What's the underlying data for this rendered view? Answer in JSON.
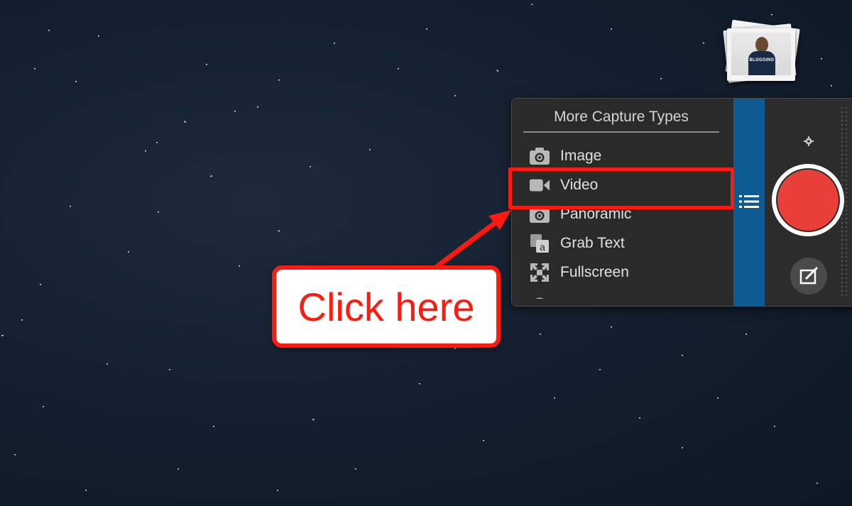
{
  "capture_menu": {
    "title": "More Capture Types",
    "items": [
      {
        "label": "Image",
        "icon": "camera-icon"
      },
      {
        "label": "Video",
        "icon": "video-camera-icon"
      },
      {
        "label": "Panoramic",
        "icon": "panoramic-camera-icon"
      },
      {
        "label": "Grab Text",
        "icon": "grab-text-icon"
      },
      {
        "label": "Fullscreen",
        "icon": "fullscreen-icon"
      }
    ]
  },
  "thumbnail": {
    "caption": "BLOGGING"
  },
  "annotation": {
    "callout_text": "Click here",
    "highlight_target": "Video",
    "color": "#ff1a10"
  },
  "colors": {
    "record": "#e84039",
    "strip": "#0e5b93",
    "panel": "#2a2a2a"
  }
}
